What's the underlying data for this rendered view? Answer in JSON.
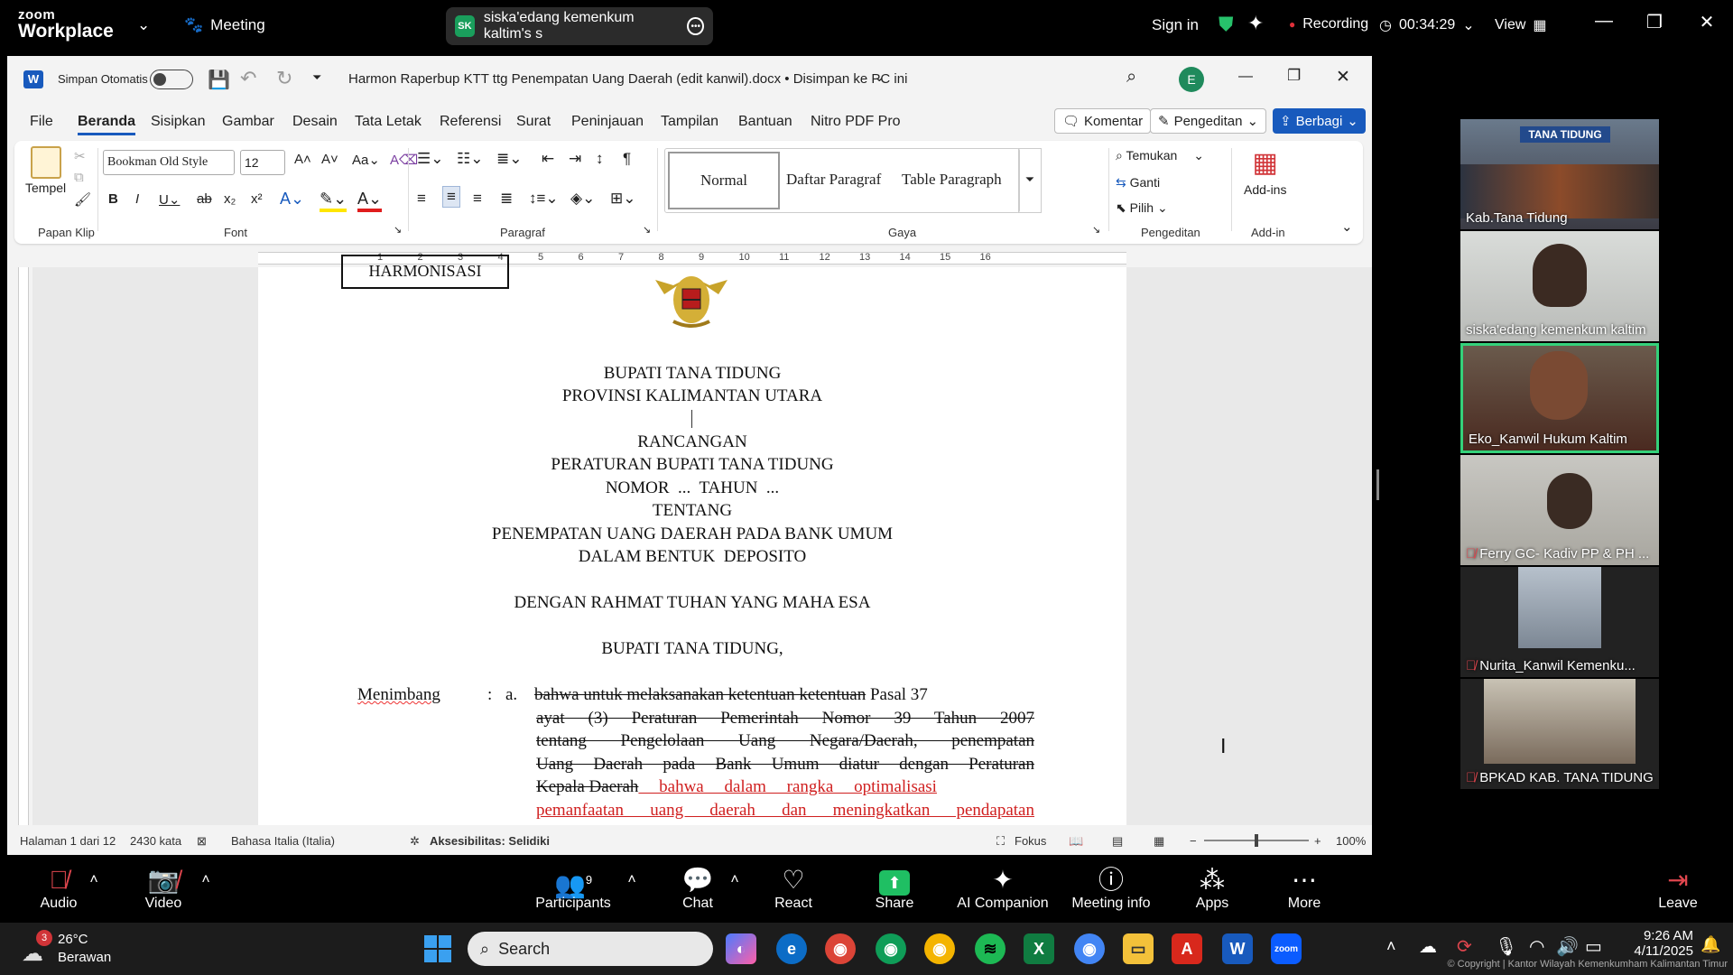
{
  "zoom_top": {
    "logo_line1": "zoom",
    "logo_line2": "Workplace",
    "meeting_label": "Meeting",
    "share_initials": "SK",
    "share_text": "siska'edang kemenkum kaltim's s",
    "sign_in": "Sign in",
    "recording": "Recording",
    "timer": "00:34:29",
    "view": "View"
  },
  "word": {
    "autosave_label": "Simpan Otomatis",
    "doc_title": "Harmon Raperbup KTT ttg Penempatan Uang Daerah (edit kanwil).docx • Disimpan ke PC ini",
    "avatar_initial": "E",
    "menu": [
      "File",
      "Beranda",
      "Sisipkan",
      "Gambar",
      "Desain",
      "Tata Letak",
      "Referensi",
      "Surat",
      "Peninjauan",
      "Tampilan",
      "Bantuan",
      "Nitro PDF Pro"
    ],
    "btn_komentar": "Komentar",
    "btn_pengeditan": "Pengeditan",
    "btn_berbagi": "Berbagi",
    "ribbon": {
      "tempel": "Tempel",
      "font_name": "Bookman Old Style",
      "font_size": "12",
      "styles": [
        "Normal",
        "Daftar Paragraf",
        "Table Paragraph"
      ],
      "temukan": "Temukan",
      "ganti": "Ganti",
      "pilih": "Pilih",
      "add_ins": "Add-ins",
      "groups": [
        "Papan Klip",
        "Font",
        "Paragraf",
        "Gaya",
        "Pengeditan",
        "Add-in"
      ]
    },
    "ruler_numbers": [
      "1",
      "2",
      "3",
      "4",
      "5",
      "6",
      "7",
      "8",
      "9",
      "10",
      "11",
      "12",
      "13",
      "14",
      "15",
      "16"
    ],
    "doc": {
      "stamp": "HARMONISASI",
      "line1": "BUPATI TANA TIDUNG",
      "line2": "PROVINSI KALIMANTAN UTARA",
      "line3": "RANCANGAN",
      "line4": "PERATURAN BUPATI TANA TIDUNG",
      "line5": "NOMOR  ...  TAHUN  ...",
      "line6": "TENTANG",
      "line7": "PENEMPATAN UANG DAERAH PADA BANK UMUM",
      "line8": "DALAM BENTUK  DEPOSITO",
      "line9": "DENGAN RAHMAT TUHAN YANG MAHA ESA",
      "line10": "BUPATI TANA TIDUNG,",
      "menimbang": "Menimbang",
      "colon": ":",
      "item_a": "a.",
      "p1_strike": "bahwa untuk melaksanakan ketentuan ketentuan",
      "p1_rest": " Pasal 37",
      "p2": "ayat (3) Peraturan Pemerintah Nomor 39 Tahun 2007",
      "p3": "tentang Pengelolaan Uang Negara/Daerah, penempatan",
      "p4": "Uang Daerah pada Bank Umum diatur dengan Peraturan",
      "p5_strike": "Kepala Daerah",
      "p5_red": " bahwa dalam rangka optimalisasi",
      "p6_red": "pemanfaatan uang daerah dan meningkatkan pendapatan"
    },
    "status": {
      "page": "Halaman 1 dari 12",
      "words": "2430 kata",
      "language": "Bahasa Italia (Italia)",
      "accessibility": "Aksesibilitas: Selidiki",
      "focus": "Fokus",
      "zoom": "100%"
    }
  },
  "participants": [
    {
      "name": "Kab.Tana Tidung",
      "banner": "TANA TIDUNG",
      "muted": false
    },
    {
      "name": "siska'edang kemenkum kaltim",
      "muted": false
    },
    {
      "name": "Eko_Kanwil Hukum Kaltim",
      "muted": false,
      "active": true
    },
    {
      "name": "Ferry GC- Kadiv PP & PH ...",
      "muted": true
    },
    {
      "name": "Nurita_Kanwil Kemenku...",
      "muted": true
    },
    {
      "name": "BPKAD KAB. TANA TIDUNG",
      "muted": true
    }
  ],
  "zoom_bar": {
    "audio": "Audio",
    "video": "Video",
    "participants": "Participants",
    "participants_count": "9",
    "chat": "Chat",
    "react": "React",
    "share": "Share",
    "ai_companion": "AI Companion",
    "meeting_info": "Meeting info",
    "apps": "Apps",
    "more": "More",
    "leave": "Leave"
  },
  "taskbar": {
    "weather_badge": "3",
    "temperature": "26°C",
    "weather": "Berawan",
    "search": "Search",
    "time": "9:26 AM",
    "date": "4/11/2025",
    "copyright": "© Copyright | Kantor Wilayah Kemenkumham Kalimantan Timur"
  }
}
